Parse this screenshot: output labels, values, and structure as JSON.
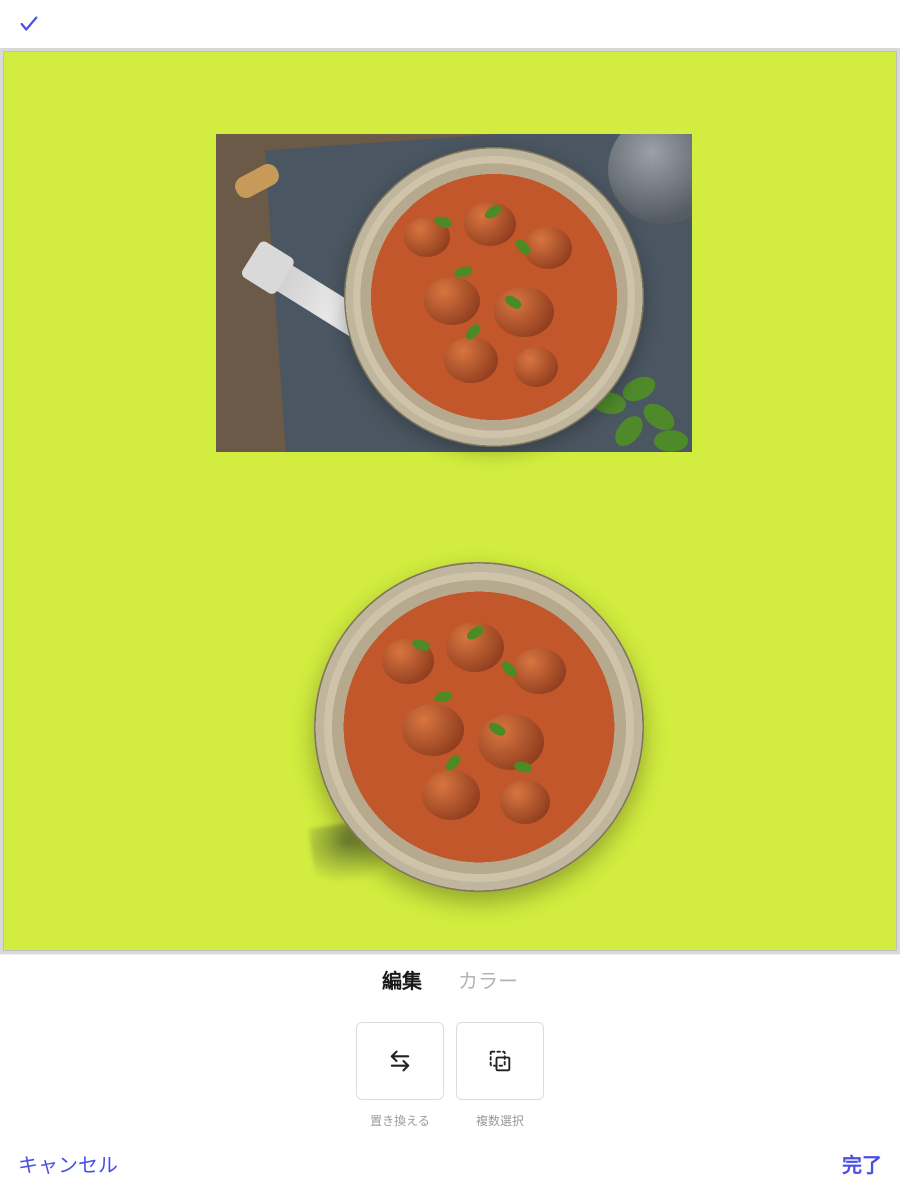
{
  "topbar": {
    "confirm_icon": "checkmark-icon"
  },
  "canvas": {
    "background_color": "#d2ed3f",
    "objects": [
      {
        "kind": "original-photo",
        "desc": "rectangular food photo with bowl of curry, fork, napkin"
      },
      {
        "kind": "cutout-bowl",
        "desc": "background-removed circular bowl of curry"
      }
    ]
  },
  "tabs": {
    "items": [
      {
        "label": "編集",
        "active": true
      },
      {
        "label": "カラー",
        "active": false
      }
    ]
  },
  "tools": {
    "items": [
      {
        "icon": "swap-icon",
        "label": "置き換える"
      },
      {
        "icon": "multiselect-icon",
        "label": "複数選択"
      }
    ]
  },
  "footer": {
    "cancel_label": "キャンセル",
    "done_label": "完了"
  },
  "colors": {
    "accent": "#4a4fe4"
  }
}
